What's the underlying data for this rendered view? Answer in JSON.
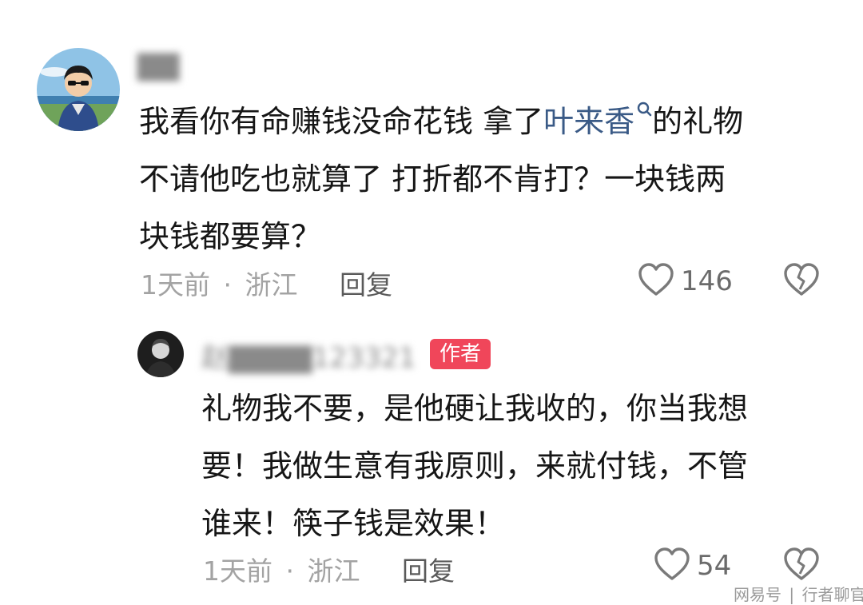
{
  "comment": {
    "username": "▇▇",
    "text_line1": "我看你有命赚钱没命花钱 拿了",
    "mention": "叶来香",
    "text_line1_end": "的礼物",
    "text_line2": "不请他吃也就算了 打折都不肯打？一块钱两",
    "text_line3": "块钱都要算？",
    "time": "1天前",
    "dot": "·",
    "location": "浙江",
    "reply_label": "回复",
    "like_count": "146"
  },
  "reply": {
    "username": "赵▇▇▇▇123321",
    "author_badge": "作者",
    "text_line1": "礼物我不要，是他硬让我收的，你当我想",
    "text_line2": "要！我做生意有我原则，来就付钱，不管",
    "text_line3": "谁来！筷子钱是效果！",
    "time": "1天前",
    "dot": "·",
    "location": "浙江",
    "reply_label": "回复",
    "like_count": "54"
  },
  "watermark": {
    "source": "网易号",
    "sep": "|",
    "account": "行者聊官"
  },
  "colors": {
    "mention": "#3a5a86",
    "author_badge": "#f0465a",
    "meta": "#a3a3a3"
  },
  "icons": [
    "heart-icon",
    "broken-heart-icon",
    "search-icon"
  ]
}
